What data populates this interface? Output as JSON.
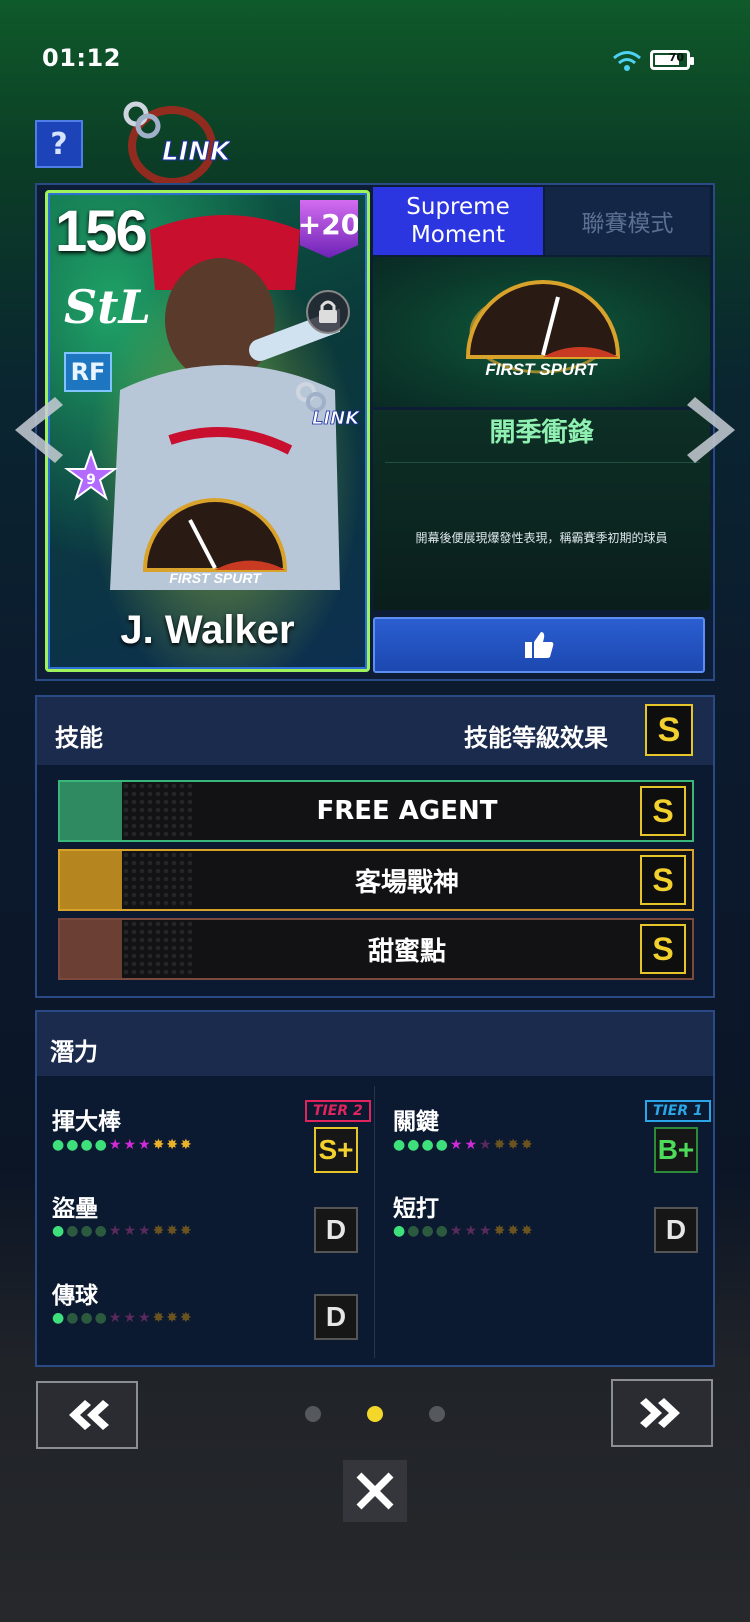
{
  "status_bar": {
    "time": "01:12",
    "battery_level": "70",
    "battery_fraction": 0.7
  },
  "header": {
    "help_label": "?",
    "link_logo_text": "LINK"
  },
  "card": {
    "rating": "156",
    "bonus": "+20",
    "team_logo": "StL",
    "position": "RF",
    "star_level": "9",
    "player_name": "J. Walker",
    "link_text": "LINK",
    "badge_text": "FIRST SPURT",
    "border_color": "#9ef25c"
  },
  "tabs": [
    {
      "line1": "Supreme",
      "line2": "Moment",
      "active": true
    },
    {
      "label": "聯賽模式",
      "active": false
    }
  ],
  "skill_detail": {
    "badge_text": "FIRST SPURT",
    "title": "開季衝鋒",
    "description": "開幕後便展現爆發性表現，稱霸賽季初期的球員"
  },
  "skills": {
    "title": "技能",
    "effect_label": "技能等級效果",
    "effect_grade": "S",
    "items": [
      {
        "name": "FREE AGENT",
        "grade": "S",
        "color": "#39b77b",
        "icon": "free-agent-icon"
      },
      {
        "name": "客場戰神",
        "grade": "S",
        "color": "#d8a22b",
        "icon": "away-jersey-icon"
      },
      {
        "name": "甜蜜點",
        "grade": "S",
        "color": "#7b4a3d",
        "icon": "sweet-spot-bat-icon"
      }
    ]
  },
  "potential": {
    "title": "潛力",
    "items": [
      {
        "label": "揮大棒",
        "grade": "S+",
        "tier": "TIER 2",
        "tier_color": "#e0245e",
        "grade_color": "#f2d02e",
        "filled_green": 4,
        "filled_pink": 3,
        "filled_gold": 3
      },
      {
        "label": "關鍵",
        "grade": "B+",
        "tier": "TIER 1",
        "tier_color": "#2aa6e8",
        "grade_color": "#4ddb5a",
        "filled_green": 4,
        "filled_pink": 2,
        "filled_gold": 0
      },
      {
        "label": "盜壘",
        "grade": "D",
        "filled_green": 1,
        "filled_pink": 0,
        "filled_gold": 0
      },
      {
        "label": "短打",
        "grade": "D",
        "filled_green": 1,
        "filled_pink": 0,
        "filled_gold": 0
      },
      {
        "label": "傳球",
        "grade": "D",
        "filled_green": 1,
        "filled_pink": 0,
        "filled_gold": 0
      }
    ]
  },
  "pagination": {
    "total": 3,
    "current": 2
  }
}
